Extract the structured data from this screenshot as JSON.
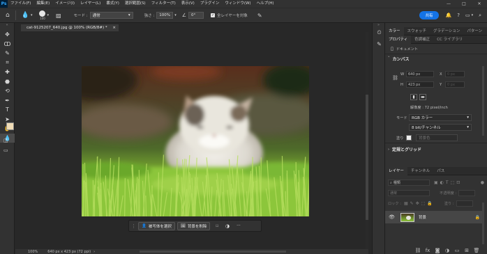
{
  "app": {
    "logo": "Ps"
  },
  "menubar": {
    "items": [
      "ファイル(F)",
      "編集(E)",
      "イメージ(I)",
      "レイヤー(L)",
      "書式(Y)",
      "選択範囲(S)",
      "フィルター(T)",
      "表示(V)",
      "プラグイン",
      "ウィンドウ(W)",
      "ヘルプ(H)"
    ],
    "window_controls": [
      "—",
      "□",
      "✕"
    ]
  },
  "optionsbar": {
    "brush_size": "100",
    "mode_label": "モード :",
    "mode_value": "通常",
    "strength_label": "強さ :",
    "strength_value": "100%",
    "angle_label": "∠",
    "angle_value": "0°",
    "sample_all_label": "全レイヤーを対象",
    "share_label": "共有"
  },
  "document": {
    "tab_title": "cat-9125207_640.jpg @ 100% (RGB/8#) *",
    "close_glyph": "×",
    "status": "100%",
    "status_info": "640 px x 423 px (72 ppi)"
  },
  "contextbar": {
    "select_subject": "被写体を選択",
    "remove_bg": "背景を削除",
    "more": "···"
  },
  "properties_panel": {
    "tabs": [
      "カラー",
      "スウォッチ",
      "グラデーション",
      "パターン"
    ],
    "subtabs": [
      "プロパティ",
      "色調補正",
      "CC ライブラリ"
    ],
    "doc_label": "ドキュメント",
    "canvas_section": "カンバス",
    "w_label": "W",
    "w_value": "640 px",
    "h_label": "H",
    "h_value": "423 px",
    "x_label": "X",
    "x_value": "0 px",
    "y_label": "Y",
    "y_value": "0 px",
    "resolution": "解像度 : 72 pixel/inch",
    "mode_label": "モード",
    "mode_value": "RGB カラー",
    "depth_value": "8 bit/チャンネル",
    "fill_label": "塗り",
    "fill_value": "背景色",
    "guides_section": "定規とグリッド"
  },
  "layers_panel": {
    "tabs": [
      "レイヤー",
      "チャンネル",
      "パス"
    ],
    "search_placeholder": "種類",
    "blend_mode": "通常",
    "opacity_label": "不透明度 :",
    "lock_label": "ロック :",
    "fill_label": "塗り :",
    "layer_name": "背景"
  }
}
